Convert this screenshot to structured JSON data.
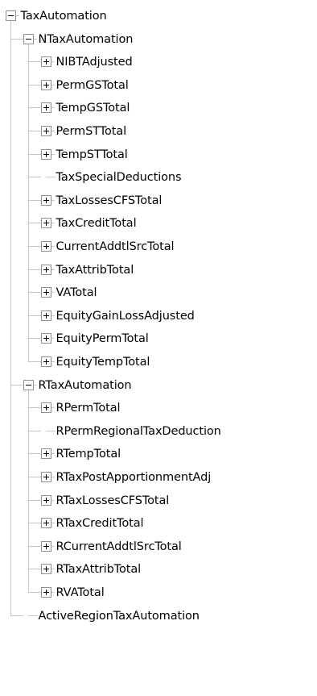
{
  "tree": {
    "root": {
      "label": "TaxAutomation",
      "expanded": true,
      "children": [
        {
          "label": "NTaxAutomation",
          "expanded": true,
          "children": [
            {
              "label": "NIBTAdjusted",
              "has_children": true
            },
            {
              "label": "PermGSTotal",
              "has_children": true
            },
            {
              "label": "TempGSTotal",
              "has_children": true
            },
            {
              "label": "PermSTTotal",
              "has_children": true
            },
            {
              "label": "TempSTTotal",
              "has_children": true
            },
            {
              "label": "TaxSpecialDeductions",
              "has_children": false
            },
            {
              "label": "TaxLossesCFSTotal",
              "has_children": true
            },
            {
              "label": "TaxCreditTotal",
              "has_children": true
            },
            {
              "label": "CurrentAddtlSrcTotal",
              "has_children": true
            },
            {
              "label": "TaxAttribTotal",
              "has_children": true
            },
            {
              "label": "VATotal",
              "has_children": true
            },
            {
              "label": "EquityGainLossAdjusted",
              "has_children": true
            },
            {
              "label": "EquityPermTotal",
              "has_children": true
            },
            {
              "label": "EquityTempTotal",
              "has_children": true
            }
          ]
        },
        {
          "label": "RTaxAutomation",
          "expanded": true,
          "children": [
            {
              "label": "RPermTotal",
              "has_children": true
            },
            {
              "label": "RPermRegionalTaxDeduction",
              "has_children": false
            },
            {
              "label": "RTempTotal",
              "has_children": true
            },
            {
              "label": "RTaxPostApportionmentAdj",
              "has_children": true
            },
            {
              "label": "RTaxLossesCFSTotal",
              "has_children": true
            },
            {
              "label": "RTaxCreditTotal",
              "has_children": true
            },
            {
              "label": "RCurrentAddtlSrcTotal",
              "has_children": true
            },
            {
              "label": "RTaxAttribTotal",
              "has_children": true
            },
            {
              "label": "RVATotal",
              "has_children": true
            }
          ]
        },
        {
          "label": "ActiveRegionTaxAutomation",
          "has_children": false
        }
      ]
    }
  }
}
